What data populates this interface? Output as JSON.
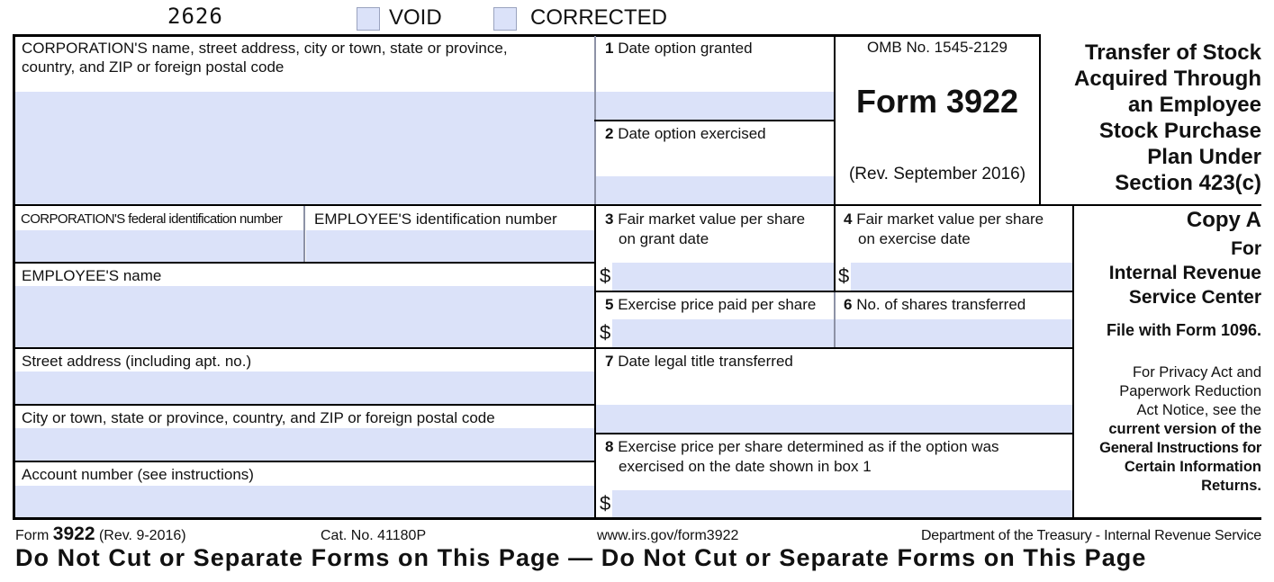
{
  "header": {
    "form_code": "2626",
    "void_label": "VOID",
    "corrected_label": "CORRECTED"
  },
  "fields": {
    "corp_name_label_1": "CORPORATION'S name, street address, city or town, state or province,",
    "corp_name_label_2": "country, and ZIP or foreign postal code",
    "corp_name_value": "",
    "corp_fed_id_label": "CORPORATION'S federal identification number",
    "corp_fed_id_value": "",
    "employee_id_label": "EMPLOYEE'S identification number",
    "employee_id_value": "",
    "employee_name_label": "EMPLOYEE'S name",
    "employee_name_value": "",
    "street_label": "Street address (including apt. no.)",
    "street_value": "",
    "city_label": "City or town, state or province, country, and ZIP or foreign postal code",
    "city_value": "",
    "account_label": "Account number (see instructions)",
    "account_value": ""
  },
  "boxes": {
    "b1_num": "1",
    "b1_label": "Date option granted",
    "b1_value": "",
    "b2_num": "2",
    "b2_label": "Date option exercised",
    "b2_value": "",
    "b3_num": "3",
    "b3_label_1": "Fair market value per share",
    "b3_label_2": "on grant date",
    "b3_value": "",
    "b4_num": "4",
    "b4_label_1": "Fair market value per share",
    "b4_label_2": "on exercise date",
    "b4_value": "",
    "b5_num": "5",
    "b5_label": "Exercise price paid per share",
    "b5_value": "",
    "b6_num": "6",
    "b6_label": "No. of shares transferred",
    "b6_value": "",
    "b7_num": "7",
    "b7_label": "Date legal title transferred",
    "b7_value": "",
    "b8_num": "8",
    "b8_label_1": "Exercise price per share determined as if the option was",
    "b8_label_2": "exercised on the date shown in box 1",
    "b8_value": "",
    "currency_symbol": "$"
  },
  "form_info": {
    "omb": "OMB No. 1545-2129",
    "form_title": "Form 3922",
    "revision": "(Rev. September 2016)",
    "title_lines": [
      "Transfer of Stock",
      "Acquired Through",
      "an Employee",
      "Stock Purchase",
      "Plan Under",
      "Section 423(c)"
    ]
  },
  "copy_info": {
    "copy": "Copy A",
    "for_lines": [
      "For",
      "Internal Revenue",
      "Service Center"
    ],
    "file_with": "File with Form 1096.",
    "privacy_lines": [
      "For Privacy Act and",
      "Paperwork Reduction",
      "Act Notice, see the"
    ],
    "privacy_bold_lines": [
      "current version of the",
      "General Instructions for",
      "Certain Information",
      "Returns."
    ]
  },
  "footer": {
    "form_prefix": "Form",
    "form_number": "3922",
    "rev": "(Rev. 9-2016)",
    "cat_no": "Cat. No. 41180P",
    "url": "www.irs.gov/form3922",
    "department": "Department of the Treasury - Internal Revenue Service",
    "warning": "Do Not Cut or Separate Forms on This Page — Do Not Cut or Separate Forms on This Page"
  }
}
